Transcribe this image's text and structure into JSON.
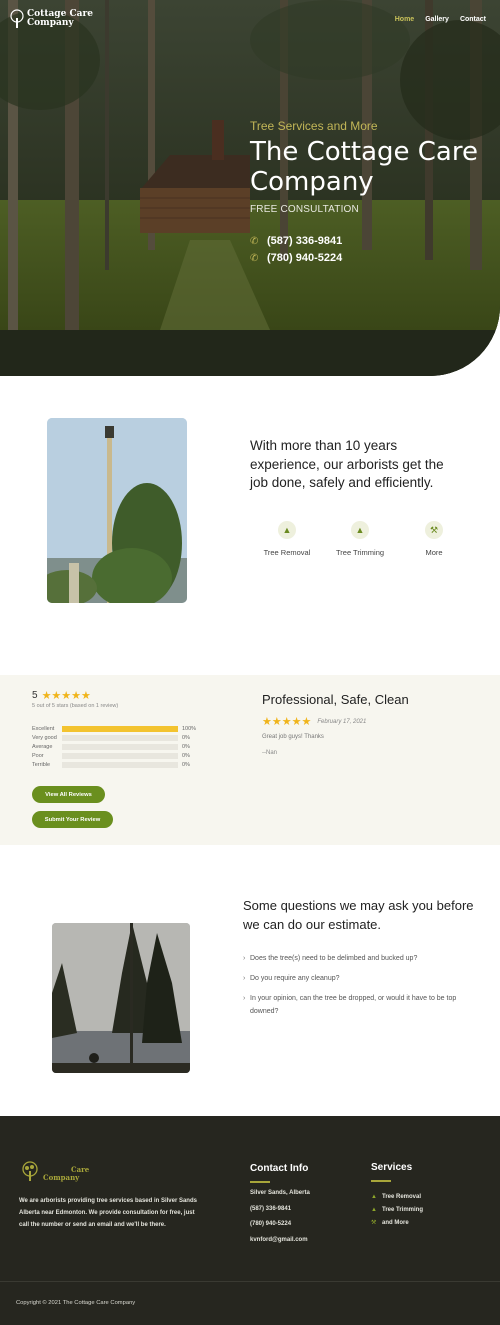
{
  "nav": {
    "logo_line1": "Cottage Care",
    "logo_line2": "Company",
    "items": [
      {
        "label": "Home",
        "active": true
      },
      {
        "label": "Gallery",
        "active": false
      },
      {
        "label": "Contact",
        "active": false
      }
    ]
  },
  "hero": {
    "eyebrow": "Tree Services and More",
    "title": "The Cottage Care Company",
    "subtitle": "FREE CONSULTATION",
    "phones": [
      "(587) 336-9841",
      "(780) 940-5224"
    ],
    "phone_icon": "phone-icon"
  },
  "about": {
    "text": "With more than 10 years experience, our arborists get the job done, safely and efficiently.",
    "services": [
      {
        "icon": "tree-icon",
        "label": "Tree Removal"
      },
      {
        "icon": "tree-icon",
        "label": "Tree Trimming"
      },
      {
        "icon": "hammer-icon",
        "label": "More"
      }
    ]
  },
  "reviews": {
    "score": "5",
    "stars_glyph": "★★★★★",
    "summary": "5 out of 5 stars (based on 1 review)",
    "breakdown": [
      {
        "label": "Excellent",
        "percent": 100,
        "value": "100%"
      },
      {
        "label": "Very good",
        "percent": 0,
        "value": "0%"
      },
      {
        "label": "Average",
        "percent": 0,
        "value": "0%"
      },
      {
        "label": "Poor",
        "percent": 0,
        "value": "0%"
      },
      {
        "label": "Terrible",
        "percent": 0,
        "value": "0%"
      }
    ],
    "view_all_label": "View All Reviews",
    "submit_label": "Submit Your Review",
    "featured": {
      "title": "Professional, Safe, Clean",
      "date": "February 17, 2021",
      "body": "Great job guys! Thanks",
      "author": "--Nan"
    }
  },
  "questions": {
    "title": "Some questions we may ask you before we can do our estimate.",
    "items": [
      "Does the tree(s) need to be delimbed and bucked up?",
      "Do you require any cleanup?",
      "In your opinion, can the tree be dropped, or would it have to be top downed?"
    ]
  },
  "footer": {
    "logo_line1": "Care",
    "logo_line2": "Company",
    "description": "We are arborists providing tree services based in Silver Sands Alberta near Edmonton. We provide consultation for free, just call the number or send an email and we'll be there.",
    "contact_heading": "Contact Info",
    "contact": [
      "Silver Sands, Alberta",
      "(587) 336-9841",
      "(780) 940-5224",
      "kvnford@gmail.com"
    ],
    "services_heading": "Services",
    "services": [
      {
        "icon": "tree-icon",
        "label": "Tree Removal"
      },
      {
        "icon": "tree-icon",
        "label": "Tree Trimming"
      },
      {
        "icon": "hammer-icon",
        "label": "and More"
      }
    ],
    "copyright": "Copyright © 2021 The Cottage Care Company"
  },
  "colors": {
    "accent": "#6a8f1e",
    "gold": "#c2b657",
    "star": "#f0b41b",
    "footer_bg": "#26261f"
  }
}
